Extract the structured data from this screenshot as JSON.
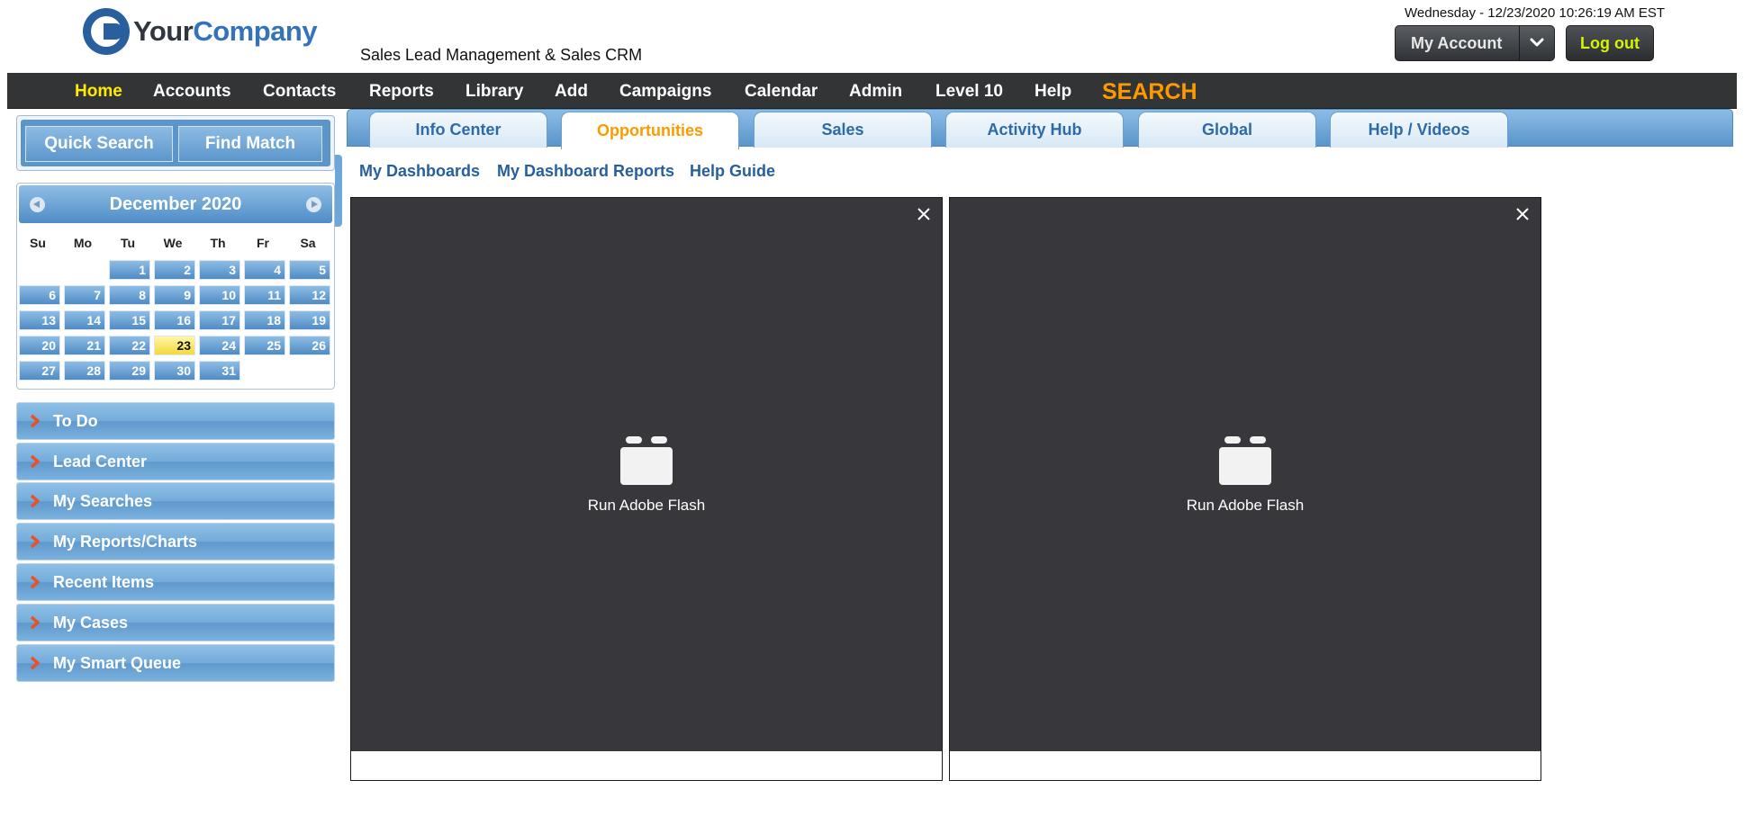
{
  "header": {
    "logo_word_1": "Your",
    "logo_word_2": "Company",
    "tagline": "Sales Lead Management & Sales CRM",
    "datetime": "Wednesday - 12/23/2020 10:26:19 AM EST",
    "my_account_label": "My Account",
    "logout_label": "Log out"
  },
  "nav": {
    "items": [
      "Home",
      "Accounts",
      "Contacts",
      "Reports",
      "Library",
      "Add",
      "Campaigns",
      "Calendar",
      "Admin",
      "Level 10",
      "Help"
    ],
    "search_label": "SEARCH",
    "active": "Home"
  },
  "sidebar": {
    "quick_search_label": "Quick Search",
    "find_match_label": "Find Match",
    "calendar": {
      "title": "December 2020",
      "weekdays": [
        "Su",
        "Mo",
        "Tu",
        "We",
        "Th",
        "Fr",
        "Sa"
      ],
      "days": [
        "1",
        "2",
        "3",
        "4",
        "5",
        "6",
        "7",
        "8",
        "9",
        "10",
        "11",
        "12",
        "13",
        "14",
        "15",
        "16",
        "17",
        "18",
        "19",
        "20",
        "21",
        "22",
        "23",
        "24",
        "25",
        "26",
        "27",
        "28",
        "29",
        "30",
        "31"
      ],
      "today": "23"
    },
    "sections": [
      "To Do",
      "Lead Center",
      "My Searches",
      "My Reports/Charts",
      "Recent Items",
      "My Cases",
      "My Smart Queue"
    ]
  },
  "tabs": {
    "items": [
      "Info Center",
      "Opportunities",
      "Sales",
      "Activity Hub",
      "Global",
      "Help / Videos"
    ],
    "active": "Opportunities"
  },
  "subnav": {
    "items": [
      "My Dashboards",
      "My Dashboard Reports",
      "Help Guide"
    ]
  },
  "panes": [
    {
      "label": "Run Adobe Flash"
    },
    {
      "label": "Run Adobe Flash"
    }
  ],
  "colors": {
    "navbar_bg": "#333436",
    "nav_active": "#ffea00",
    "search_accent": "#ff9900",
    "tab_active_text": "#ff9900",
    "link_blue": "#275f9c",
    "panel_blue": "#5b95ca",
    "flash_bg": "#38383c",
    "today_highlight": "#f4d83a",
    "logout_text": "#d6f400"
  },
  "icons": {
    "logo": "company-logo-icon",
    "dropdown": "chevron-down-icon",
    "calendar_prev": "chevron-left-circle-icon",
    "calendar_next": "chevron-right-circle-icon",
    "section_arrow": "chevron-right-icon",
    "pane_close": "close-icon",
    "flash_plugin": "plugin-icon"
  }
}
